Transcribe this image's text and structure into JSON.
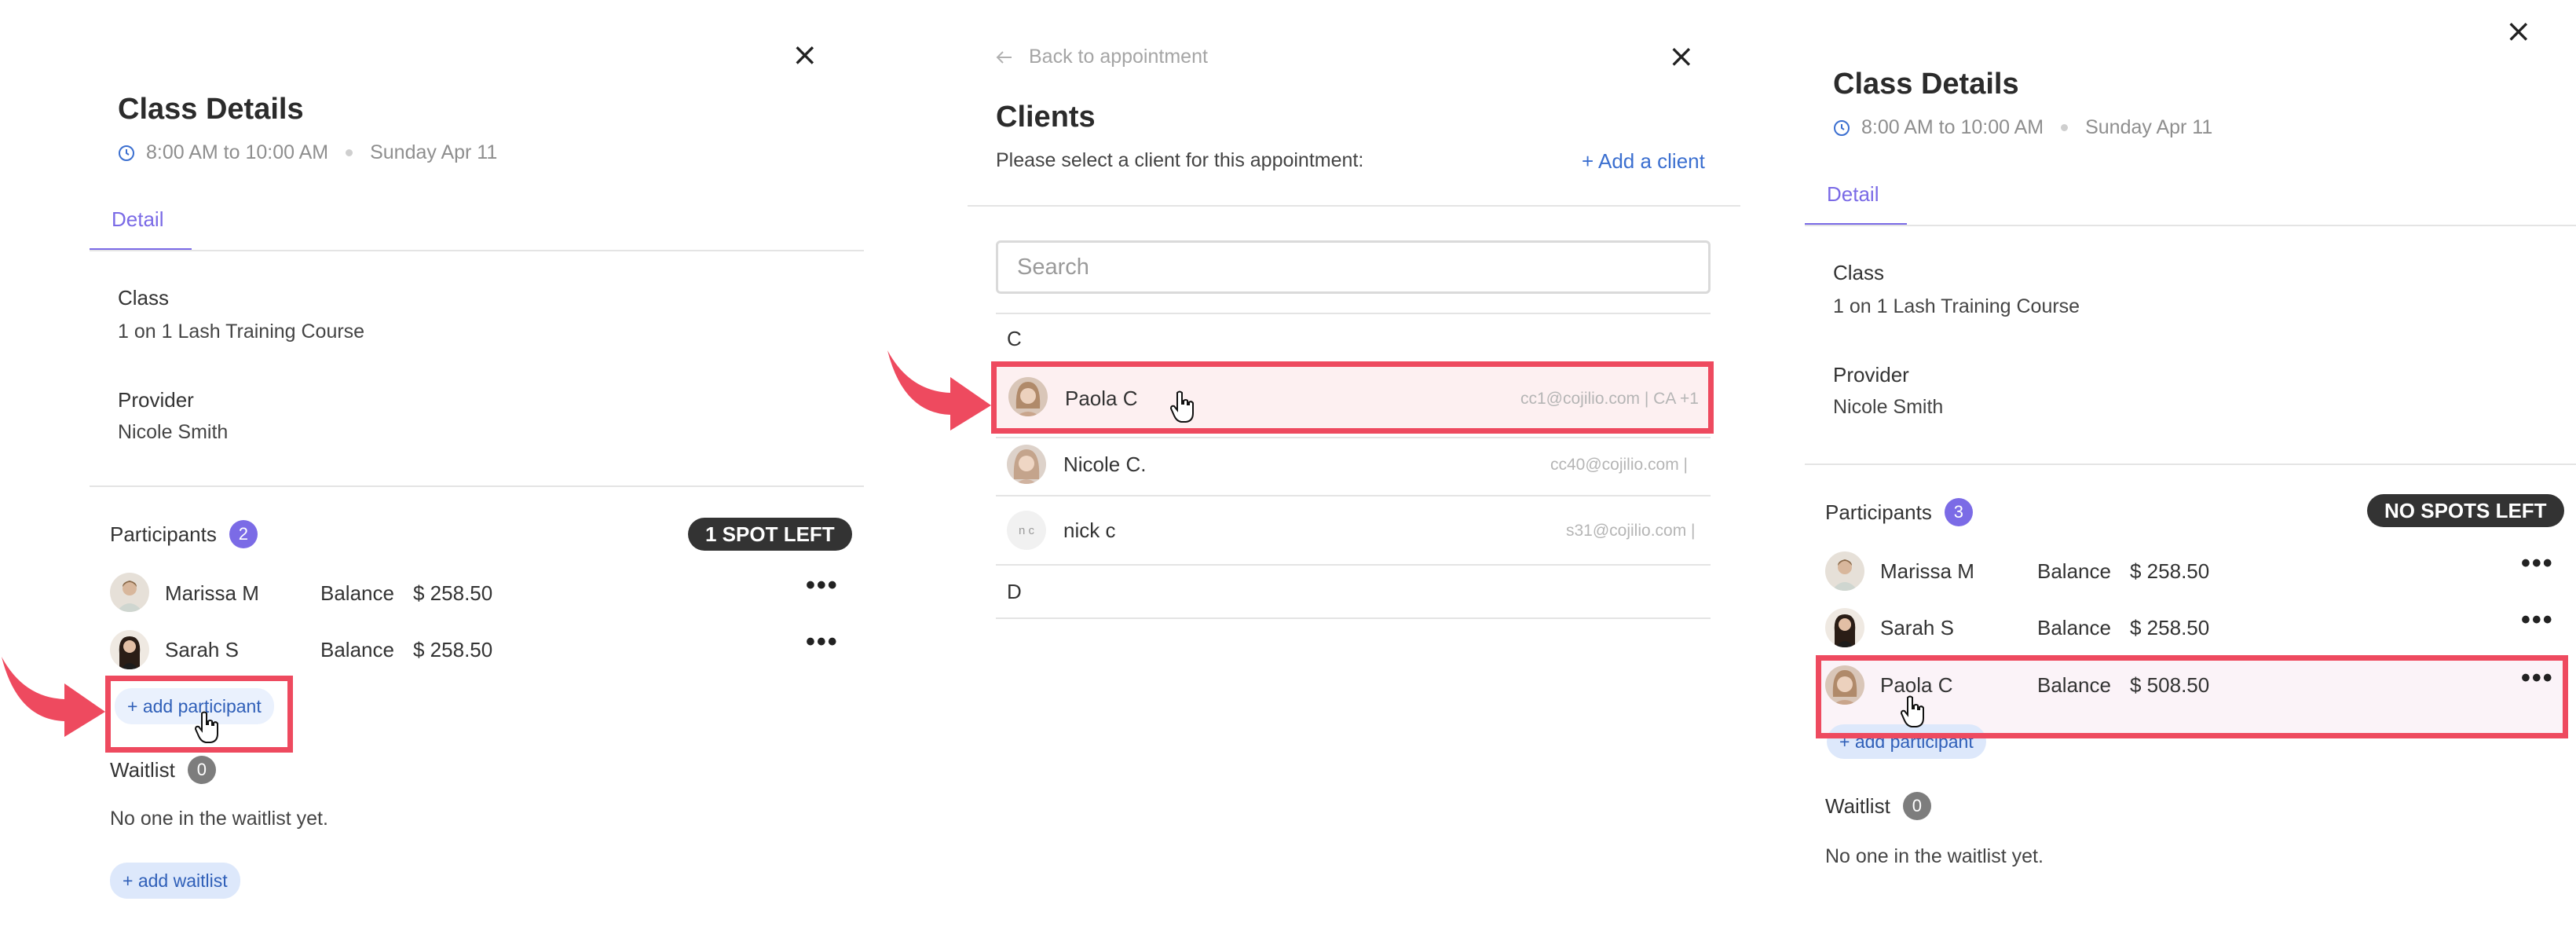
{
  "panel_left": {
    "close_glyph": "×",
    "title": "Class Details",
    "time": "8:00 AM to 10:00 AM",
    "date": "Sunday Apr 11",
    "tab": "Detail",
    "class_label": "Class",
    "class_value": "1 on 1 Lash Training Course",
    "provider_label": "Provider",
    "provider_value": "Nicole Smith",
    "participants_label": "Participants",
    "participants_count": "2",
    "spots_badge": "1 SPOT LEFT",
    "participants": [
      {
        "name": "Marissa M",
        "balance_label": "Balance",
        "balance": "$ 258.50"
      },
      {
        "name": "Sarah S",
        "balance_label": "Balance",
        "balance": "$ 258.50"
      }
    ],
    "add_participant": "+ add participant",
    "waitlist_label": "Waitlist",
    "waitlist_count": "0",
    "waitlist_empty": "No one in the waitlist yet.",
    "add_waitlist": "+ add waitlist"
  },
  "panel_middle": {
    "back_label": "Back to appointment",
    "close_glyph": "×",
    "title": "Clients",
    "instruction": "Please select a client for this appointment:",
    "add_client": "+ Add a client",
    "search_placeholder": "Search",
    "groups": [
      {
        "letter": "C"
      },
      {
        "letter": "D"
      }
    ],
    "clients": [
      {
        "name": "Paola C",
        "email": "cc1@cojilio.com | CA +1"
      },
      {
        "name": "Nicole C.",
        "email": "cc40@cojilio.com |"
      },
      {
        "name": "nick c",
        "initials": "n c",
        "email": "s31@cojilio.com |"
      }
    ]
  },
  "panel_right": {
    "close_glyph": "×",
    "title": "Class Details",
    "time": "8:00 AM to 10:00 AM",
    "date": "Sunday Apr 11",
    "tab": "Detail",
    "class_label": "Class",
    "class_value": "1 on 1 Lash Training Course",
    "provider_label": "Provider",
    "provider_value": "Nicole Smith",
    "participants_label": "Participants",
    "participants_count": "3",
    "spots_badge": "NO SPOTS LEFT",
    "participants": [
      {
        "name": "Marissa M",
        "balance_label": "Balance",
        "balance": "$ 258.50"
      },
      {
        "name": "Sarah S",
        "balance_label": "Balance",
        "balance": "$ 258.50"
      },
      {
        "name": "Paola C",
        "balance_label": "Balance",
        "balance": "$ 508.50"
      }
    ],
    "add_participant": "+ add participant",
    "waitlist_label": "Waitlist",
    "waitlist_count": "0",
    "waitlist_empty": "No one in the waitlist yet."
  },
  "icons": {
    "clock": "clock-icon",
    "close": "close-icon",
    "more": "more-horizontal-icon",
    "arrow": "red-pointer-arrow",
    "cursor": "hand-cursor-icon",
    "back": "arrow-left-icon"
  },
  "colors": {
    "accent_purple": "#7a6ae6",
    "highlight_red": "#ee4a5f",
    "link_blue": "#3b6fd0",
    "pill_bg": "#dde8fb",
    "badge_dark": "#333333"
  }
}
